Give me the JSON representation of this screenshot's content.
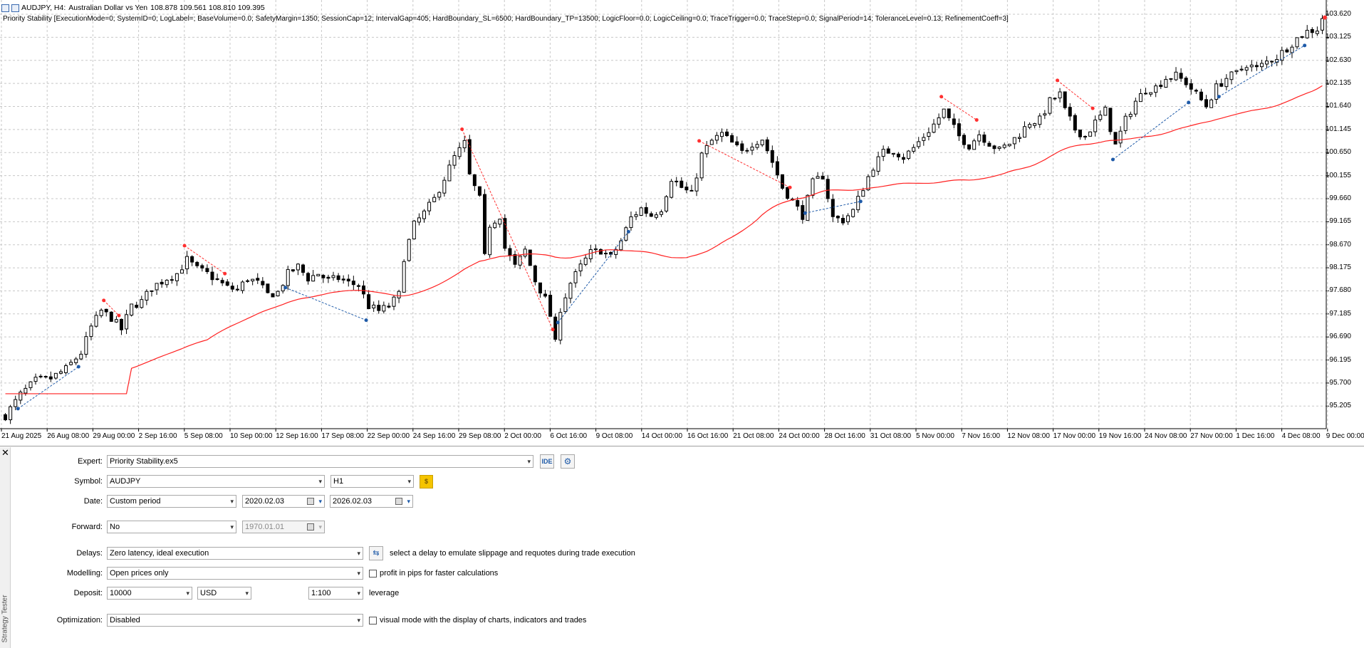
{
  "chart": {
    "symbol_period": "AUDJPY, H4:",
    "symbol_desc": "Australian Dollar vs Yen",
    "ohlc": "108.878 109.561 108.810 109.395",
    "indicator_line": "Priority Stability [ExecutionMode=0; SystemID=0; LogLabel=; BaseVolume=0.0; SafetyMargin=1350; SessionCap=12; IntervalGap=405; HardBoundary_SL=6500; HardBoundary_TP=13500; LogicFloor=0.0; LogicCeiling=0.0; TraceTrigger=0.0; TraceStep=0.0; SignalPeriod=14; ToleranceLevel=0.13; RefinementCoeff=3]",
    "y_ticks": [
      "103.620",
      "103.125",
      "102.630",
      "102.135",
      "101.640",
      "101.145",
      "100.650",
      "100.155",
      "99.660",
      "99.165",
      "98.670",
      "98.175",
      "97.680",
      "97.185",
      "96.690",
      "96.195",
      "95.700",
      "95.205"
    ],
    "x_ticks": [
      "21 Aug 2025",
      "26 Aug 08:00",
      "29 Aug 00:00",
      "2 Sep 16:00",
      "5 Sep 08:00",
      "10 Sep 00:00",
      "12 Sep 16:00",
      "17 Sep 08:00",
      "22 Sep 00:00",
      "24 Sep 16:00",
      "29 Sep 08:00",
      "2 Oct 00:00",
      "6 Oct 16:00",
      "9 Oct 08:00",
      "14 Oct 00:00",
      "16 Oct 16:00",
      "21 Oct 08:00",
      "24 Oct 00:00",
      "28 Oct 16:00",
      "31 Oct 08:00",
      "5 Nov 00:00",
      "7 Nov 16:00",
      "12 Nov 08:00",
      "17 Nov 00:00",
      "19 Nov 16:00",
      "24 Nov 08:00",
      "27 Nov 00:00",
      "1 Dec 16:00",
      "4 Dec 08:00",
      "9 Dec 00:00"
    ],
    "colors": {
      "ma": "#ff2020",
      "sell_marker": "#ff3030",
      "buy_marker": "#1e5aa8",
      "grid": "#c8c8c8",
      "candle": "#000000"
    }
  },
  "chart_data": {
    "type": "candlestick",
    "title": "AUDJPY, H4",
    "ylim": [
      94.9,
      104.0
    ],
    "close_path": [
      [
        0,
        95.0
      ],
      [
        3,
        95.45
      ],
      [
        6,
        95.75
      ],
      [
        9,
        95.8
      ],
      [
        12,
        96.0
      ],
      [
        15,
        96.35
      ],
      [
        17,
        96.9
      ],
      [
        19,
        97.25
      ],
      [
        21,
        97.1
      ],
      [
        23,
        96.85
      ],
      [
        25,
        97.35
      ],
      [
        27,
        97.45
      ],
      [
        29,
        97.75
      ],
      [
        32,
        97.95
      ],
      [
        34,
        98.05
      ],
      [
        36,
        98.35
      ],
      [
        38,
        98.15
      ],
      [
        40,
        98.05
      ],
      [
        42,
        97.9
      ],
      [
        44,
        97.75
      ],
      [
        46,
        97.7
      ],
      [
        48,
        97.95
      ],
      [
        50,
        97.85
      ],
      [
        52,
        97.6
      ],
      [
        54,
        97.65
      ],
      [
        56,
        98.05
      ],
      [
        58,
        98.2
      ],
      [
        60,
        97.95
      ],
      [
        62,
        98.05
      ],
      [
        64,
        97.9
      ],
      [
        66,
        97.95
      ],
      [
        68,
        97.85
      ],
      [
        70,
        97.8
      ],
      [
        72,
        97.35
      ],
      [
        74,
        97.25
      ],
      [
        76,
        97.35
      ],
      [
        78,
        97.6
      ],
      [
        79,
        98.4
      ],
      [
        81,
        99.1
      ],
      [
        83,
        99.35
      ],
      [
        85,
        99.65
      ],
      [
        87,
        100.1
      ],
      [
        89,
        100.55
      ],
      [
        91,
        100.85
      ],
      [
        92,
        100.15
      ],
      [
        94,
        99.65
      ],
      [
        95,
        98.4
      ],
      [
        96,
        99.1
      ],
      [
        98,
        99.3
      ],
      [
        99,
        98.6
      ],
      [
        101,
        98.2
      ],
      [
        103,
        98.55
      ],
      [
        105,
        97.9
      ],
      [
        107,
        97.5
      ],
      [
        108,
        97.15
      ],
      [
        109,
        96.55
      ],
      [
        110,
        97.3
      ],
      [
        112,
        97.85
      ],
      [
        114,
        98.2
      ],
      [
        116,
        98.5
      ],
      [
        118,
        98.55
      ],
      [
        120,
        98.4
      ],
      [
        122,
        98.75
      ],
      [
        124,
        99.25
      ],
      [
        126,
        99.45
      ],
      [
        128,
        99.3
      ],
      [
        130,
        99.45
      ],
      [
        132,
        100.1
      ],
      [
        134,
        99.9
      ],
      [
        136,
        99.75
      ],
      [
        138,
        100.6
      ],
      [
        140,
        100.9
      ],
      [
        142,
        101.05
      ],
      [
        144,
        100.85
      ],
      [
        146,
        100.65
      ],
      [
        148,
        100.85
      ],
      [
        150,
        100.95
      ],
      [
        152,
        100.45
      ],
      [
        154,
        99.9
      ],
      [
        156,
        99.6
      ],
      [
        158,
        99.3
      ],
      [
        160,
        100.0
      ],
      [
        162,
        100.15
      ],
      [
        164,
        99.25
      ],
      [
        166,
        99.2
      ],
      [
        168,
        99.4
      ],
      [
        170,
        99.9
      ],
      [
        172,
        100.35
      ],
      [
        174,
        100.65
      ],
      [
        176,
        100.7
      ],
      [
        178,
        100.55
      ],
      [
        180,
        100.75
      ],
      [
        182,
        101.0
      ],
      [
        184,
        101.25
      ],
      [
        186,
        101.55
      ],
      [
        187,
        101.35
      ],
      [
        189,
        101.0
      ],
      [
        191,
        100.8
      ],
      [
        193,
        101.05
      ],
      [
        195,
        100.85
      ],
      [
        197,
        100.7
      ],
      [
        199,
        100.85
      ],
      [
        201,
        101.05
      ],
      [
        203,
        101.3
      ],
      [
        205,
        101.35
      ],
      [
        207,
        101.75
      ],
      [
        209,
        101.9
      ],
      [
        210,
        101.55
      ],
      [
        212,
        101.15
      ],
      [
        214,
        101.0
      ],
      [
        216,
        101.3
      ],
      [
        218,
        101.55
      ],
      [
        220,
        100.8
      ],
      [
        222,
        101.35
      ],
      [
        224,
        101.75
      ],
      [
        226,
        102.0
      ],
      [
        228,
        102.05
      ],
      [
        230,
        102.25
      ],
      [
        232,
        102.3
      ],
      [
        234,
        102.15
      ],
      [
        236,
        101.9
      ],
      [
        238,
        101.65
      ],
      [
        240,
        102.05
      ],
      [
        242,
        102.25
      ],
      [
        244,
        102.35
      ],
      [
        246,
        102.55
      ],
      [
        248,
        102.45
      ],
      [
        250,
        102.6
      ],
      [
        252,
        102.7
      ],
      [
        254,
        102.9
      ],
      [
        256,
        103.1
      ],
      [
        258,
        103.25
      ],
      [
        260,
        103.3
      ],
      [
        261,
        103.55
      ]
    ]
  },
  "tester": {
    "title": "Strategy Tester",
    "expert_label": "Expert:",
    "expert_value": "Priority Stability.ex5",
    "ide_label": "IDE",
    "symbol_label": "Symbol:",
    "symbol_value": "AUDJPY",
    "timeframe_value": "H1",
    "date_label": "Date:",
    "date_mode": "Custom period",
    "date_from": "2020.02.03",
    "date_to": "2026.02.03",
    "forward_label": "Forward:",
    "forward_value": "No",
    "forward_date": "1970.01.01",
    "delays_label": "Delays:",
    "delays_value": "Zero latency, ideal execution",
    "delays_hint": "select a delay to emulate slippage and requotes during trade execution",
    "modelling_label": "Modelling:",
    "modelling_value": "Open prices only",
    "pips_checkbox_label": "profit in pips for faster calculations",
    "deposit_label": "Deposit:",
    "deposit_value": "10000",
    "currency_value": "USD",
    "leverage_value": "1:100",
    "leverage_label": "leverage",
    "optimization_label": "Optimization:",
    "optimization_value": "Disabled",
    "visual_checkbox_label": "visual mode with the display of charts, indicators and trades"
  }
}
